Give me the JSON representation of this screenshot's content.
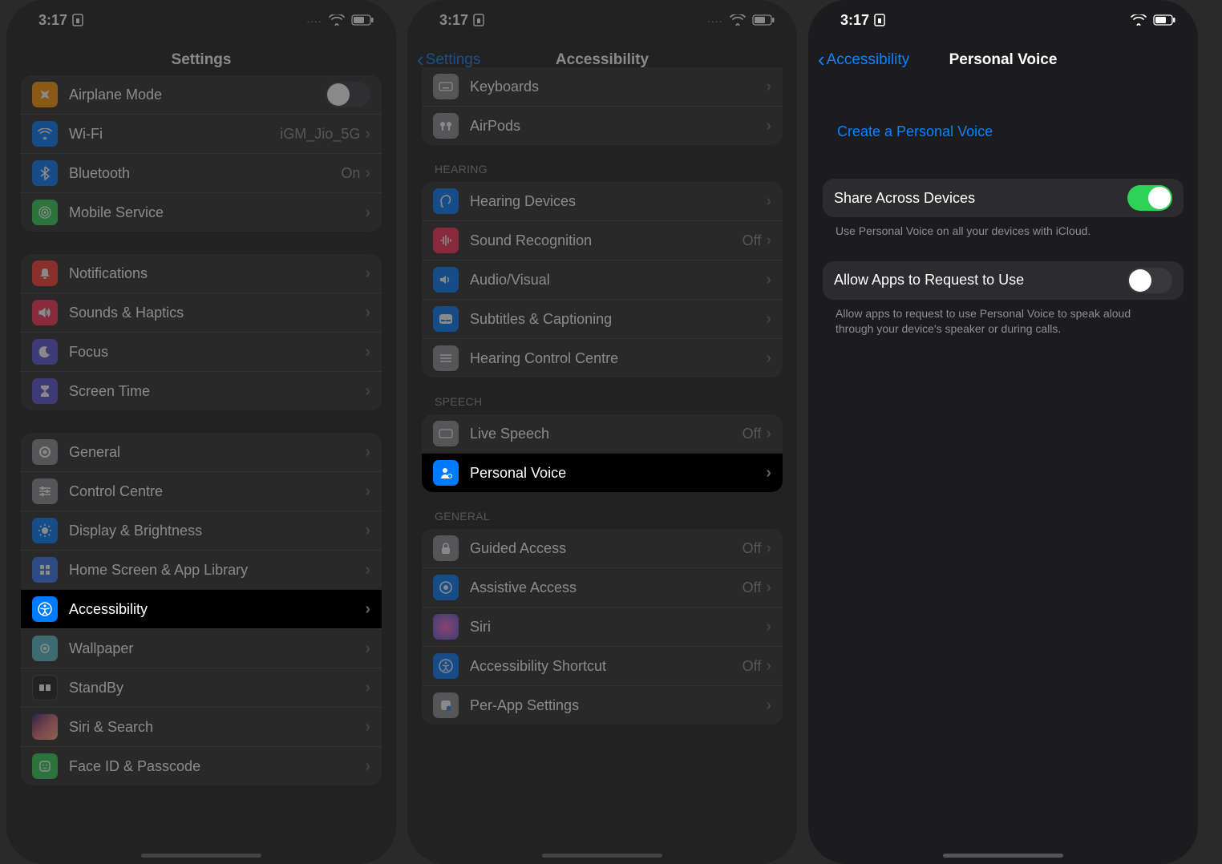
{
  "status": {
    "time": "3:17",
    "dots": "....",
    "wifi": true
  },
  "screens": {
    "settings": {
      "title": "Settings",
      "groups": [
        {
          "rows": [
            {
              "icon": "airplane",
              "bg": "#ff9500",
              "label": "Airplane Mode",
              "toggle": "off"
            },
            {
              "icon": "wifi",
              "bg": "#007aff",
              "label": "Wi-Fi",
              "value": "iGM_Jio_5G",
              "chevron": true
            },
            {
              "icon": "bluetooth",
              "bg": "#007aff",
              "label": "Bluetooth",
              "value": "On",
              "chevron": true
            },
            {
              "icon": "cell",
              "bg": "#30d158",
              "label": "Mobile Service",
              "chevron": true
            }
          ]
        },
        {
          "rows": [
            {
              "icon": "bell",
              "bg": "#ff3b30",
              "label": "Notifications",
              "chevron": true
            },
            {
              "icon": "sound",
              "bg": "#ff2d55",
              "label": "Sounds & Haptics",
              "chevron": true
            },
            {
              "icon": "moon",
              "bg": "#5856d6",
              "label": "Focus",
              "chevron": true
            },
            {
              "icon": "hourglass",
              "bg": "#5856d6",
              "label": "Screen Time",
              "chevron": true
            }
          ]
        },
        {
          "rows": [
            {
              "icon": "gear",
              "bg": "#8e8e93",
              "label": "General",
              "chevron": true
            },
            {
              "icon": "sliders",
              "bg": "#8e8e93",
              "label": "Control Centre",
              "chevron": true
            },
            {
              "icon": "brightness",
              "bg": "#007aff",
              "label": "Display & Brightness",
              "chevron": true
            },
            {
              "icon": "grid",
              "bg": "#3478f6",
              "label": "Home Screen & App Library",
              "chevron": true
            },
            {
              "icon": "accessibility",
              "bg": "#007aff",
              "label": "Accessibility",
              "chevron": true,
              "highlight": true
            },
            {
              "icon": "wallpaper",
              "bg": "#55bdc8",
              "label": "Wallpaper",
              "chevron": true
            },
            {
              "icon": "standby",
              "bg": "#1c1c1e",
              "label": "StandBy",
              "chevron": true
            },
            {
              "icon": "siri",
              "bg": "#1c1c1e",
              "label": "Siri & Search",
              "chevron": true
            },
            {
              "icon": "faceid",
              "bg": "#30d158",
              "label": "Face ID & Passcode",
              "chevron": true
            }
          ]
        }
      ]
    },
    "accessibility": {
      "back": "Settings",
      "title": "Accessibility",
      "partial_top_rows": [
        {
          "icon": "keyboard",
          "bg": "#8e8e93",
          "label": "Keyboards",
          "chevron": true
        },
        {
          "icon": "airpods",
          "bg": "#8e8e93",
          "label": "AirPods",
          "chevron": true
        }
      ],
      "sections": [
        {
          "header": "HEARING",
          "rows": [
            {
              "icon": "ear",
              "bg": "#007aff",
              "label": "Hearing Devices",
              "chevron": true
            },
            {
              "icon": "soundrec",
              "bg": "#ff2d55",
              "label": "Sound Recognition",
              "value": "Off",
              "chevron": true
            },
            {
              "icon": "av",
              "bg": "#007aff",
              "label": "Audio/Visual",
              "chevron": true
            },
            {
              "icon": "caption",
              "bg": "#007aff",
              "label": "Subtitles & Captioning",
              "chevron": true
            },
            {
              "icon": "hearingctrl",
              "bg": "#8e8e93",
              "label": "Hearing Control Centre",
              "chevron": true
            }
          ]
        },
        {
          "header": "SPEECH",
          "rows": [
            {
              "icon": "livespeech",
              "bg": "#8e8e93",
              "label": "Live Speech",
              "value": "Off",
              "chevron": true
            },
            {
              "icon": "personalvoice",
              "bg": "#007aff",
              "label": "Personal Voice",
              "chevron": true,
              "highlight": true
            }
          ]
        },
        {
          "header": "GENERAL",
          "rows": [
            {
              "icon": "lock",
              "bg": "#8e8e93",
              "label": "Guided Access",
              "value": "Off",
              "chevron": true
            },
            {
              "icon": "assistive",
              "bg": "#007aff",
              "label": "Assistive Access",
              "value": "Off",
              "chevron": true
            },
            {
              "icon": "sirimini",
              "bg": "#1c1c1e",
              "label": "Siri",
              "chevron": true
            },
            {
              "icon": "shortcut",
              "bg": "#007aff",
              "label": "Accessibility Shortcut",
              "value": "Off",
              "chevron": true
            },
            {
              "icon": "perapp",
              "bg": "#8e8e93",
              "label": "Per-App Settings",
              "chevron": true
            }
          ]
        }
      ]
    },
    "pvoice": {
      "back": "Accessibility",
      "title": "Personal Voice",
      "create": "Create a Personal Voice",
      "share": {
        "label": "Share Across Devices",
        "on": true,
        "footer": "Use Personal Voice on all your devices with iCloud."
      },
      "allow": {
        "label": "Allow Apps to Request to Use",
        "on": false,
        "footer": "Allow apps to request to use Personal Voice to speak aloud through your device's speaker or during calls."
      }
    }
  }
}
